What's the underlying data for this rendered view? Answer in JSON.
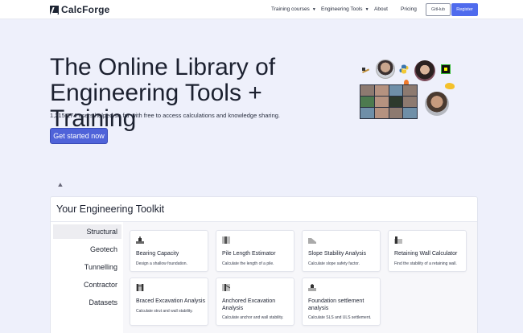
{
  "nav": {
    "brand_prefix": "Calc",
    "brand_suffix": "Forge",
    "items": [
      {
        "label": "Training courses",
        "has_caret": true
      },
      {
        "label": "Engineering Tools",
        "has_caret": true
      },
      {
        "label": "About",
        "has_caret": false
      },
      {
        "label": "Pricing",
        "has_caret": false
      }
    ],
    "github_label": "GitHub",
    "register_label": "Register"
  },
  "hero": {
    "title_line1": "The Online Library of",
    "title_line2": "Engineering Tools + Training",
    "subtitle": "1,215,174 users helped so far with free to access calculations and knowledge sharing.",
    "cta_label": "Get started now"
  },
  "toolkit": {
    "title": "Your Engineering Toolkit",
    "categories": [
      {
        "label": "Structural",
        "active": true
      },
      {
        "label": "Geotech",
        "active": false
      },
      {
        "label": "Tunnelling",
        "active": false
      },
      {
        "label": "Contractor",
        "active": false
      },
      {
        "label": "Datasets",
        "active": false
      }
    ],
    "tools": [
      {
        "title": "Bearing Capacity",
        "desc": "Design a shallow foundation.",
        "icon": "foundation-icon"
      },
      {
        "title": "Pile Length Estimator",
        "desc": "Calculate the length of a pile.",
        "icon": "pile-icon"
      },
      {
        "title": "Slope Stability Analysis",
        "desc": "Calculate slope safety factor.",
        "icon": "slope-icon"
      },
      {
        "title": "Retaining Wall Calculator",
        "desc": "Find the stability of a retaining wall.",
        "icon": "retaining-wall-icon"
      },
      {
        "title": "Braced Excavation Analysis",
        "desc": "Calculate strut and wall stability.",
        "icon": "braced-excavation-icon"
      },
      {
        "title": "Anchored Excavation Analysis",
        "desc": "Calculate anchor and wall stability.",
        "icon": "anchored-excavation-icon"
      },
      {
        "title": "Foundation settlement analysis",
        "desc": "Calculate SLS and ULS settlement.",
        "icon": "settlement-icon"
      }
    ]
  }
}
